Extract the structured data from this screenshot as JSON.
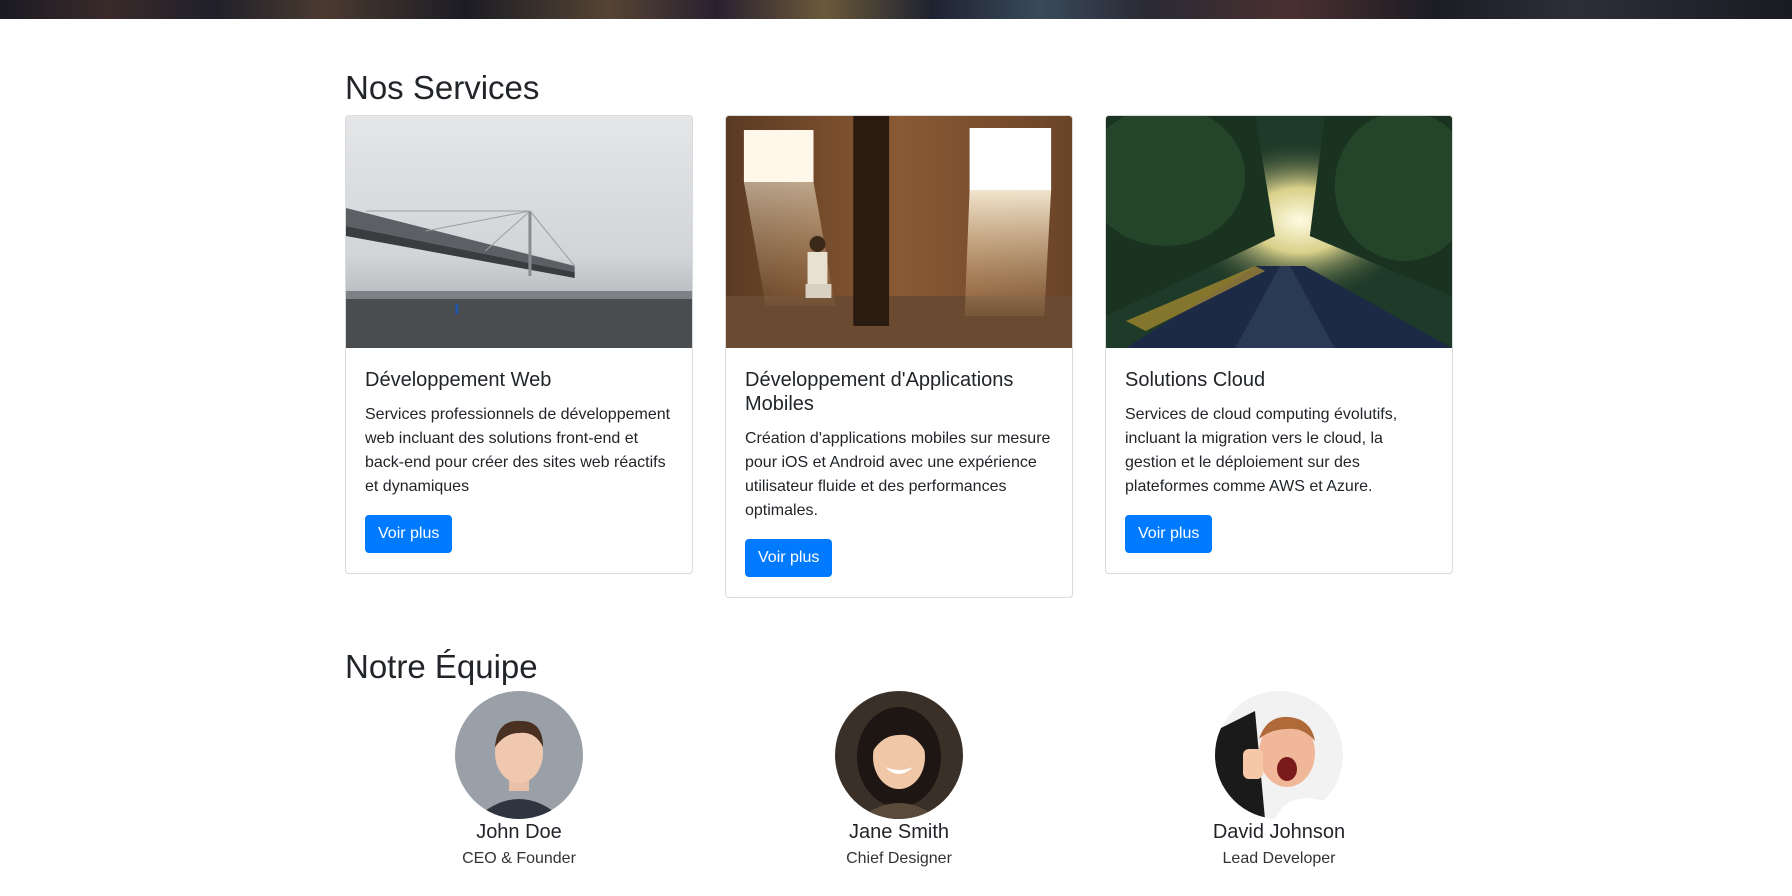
{
  "services": {
    "title": "Nos Services",
    "cards": [
      {
        "image": "foggy-bridge-photo",
        "title": "Développement Web",
        "text": "Services professionnels de développement web incluant des solutions front-end et back-end pour créer des sites web réactifs et dynamiques",
        "button": "Voir plus"
      },
      {
        "image": "person-in-sunlit-warehouse-photo",
        "title": "Développement d'Applications Mobiles",
        "text": "Création d'applications mobiles sur mesure pour iOS et Android avec une expérience utilisateur fluide et des performances optimales.",
        "button": "Voir plus"
      },
      {
        "image": "tree-lined-road-sunset-photo",
        "title": "Solutions Cloud",
        "text": "Services de cloud computing évolutifs, incluant la migration vers le cloud, la gestion et le déploiement sur des plateformes comme AWS et Azure.",
        "button": "Voir plus"
      }
    ]
  },
  "team": {
    "title": "Notre Équipe",
    "members": [
      {
        "name": "John Doe",
        "role": "CEO & Founder",
        "avatar": "man-portrait-photo"
      },
      {
        "name": "Jane Smith",
        "role": "Chief Designer",
        "avatar": "woman-smiling-portrait-photo"
      },
      {
        "name": "David Johnson",
        "role": "Lead Developer",
        "avatar": "excited-man-thumbs-up-photo"
      }
    ]
  },
  "colors": {
    "primary": "#007bff",
    "text": "#212529"
  }
}
